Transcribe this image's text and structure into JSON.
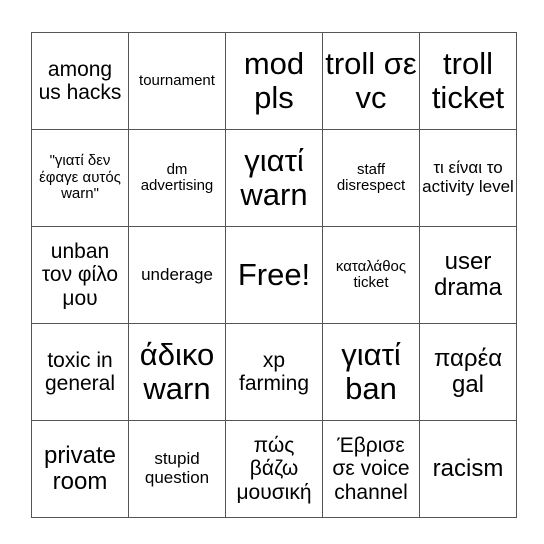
{
  "board": {
    "rows": [
      [
        {
          "text": "among us hacks",
          "size": "s-md"
        },
        {
          "text": "tournament",
          "size": "s-xs"
        },
        {
          "text": "mod pls",
          "size": "s-xl"
        },
        {
          "text": "troll σε vc",
          "size": "s-xl"
        },
        {
          "text": "troll ticket",
          "size": "s-xl"
        }
      ],
      [
        {
          "text": "\"γιατί δεν έφαγε αυτός warn\"",
          "size": "s-xs"
        },
        {
          "text": "dm advertising",
          "size": "s-xs"
        },
        {
          "text": "γιατί warn",
          "size": "s-xl"
        },
        {
          "text": "staff disrespect",
          "size": "s-xs"
        },
        {
          "text": "τι είναι το activity level",
          "size": "s-sm"
        }
      ],
      [
        {
          "text": "unban τον φίλο μου",
          "size": "s-md"
        },
        {
          "text": "underage",
          "size": "s-sm"
        },
        {
          "text": "Free!",
          "size": "s-xl",
          "free": true
        },
        {
          "text": "καταλάθος ticket",
          "size": "s-xs"
        },
        {
          "text": "user drama",
          "size": "s-lg"
        }
      ],
      [
        {
          "text": "toxic in general",
          "size": "s-md"
        },
        {
          "text": "άδικο warn",
          "size": "s-xl"
        },
        {
          "text": "xp farming",
          "size": "s-md"
        },
        {
          "text": "γιατί ban",
          "size": "s-xl"
        },
        {
          "text": "παρέα gal",
          "size": "s-lg"
        }
      ],
      [
        {
          "text": "private room",
          "size": "s-lg"
        },
        {
          "text": "stupid question",
          "size": "s-sm"
        },
        {
          "text": "πώς βάζω μουσική",
          "size": "s-md"
        },
        {
          "text": "Έβρισε σε voice channel",
          "size": "s-md"
        },
        {
          "text": "racism",
          "size": "s-lg"
        }
      ]
    ]
  },
  "colors": {
    "grid_line": "#555555",
    "text": "#000000",
    "background": "#ffffff"
  }
}
